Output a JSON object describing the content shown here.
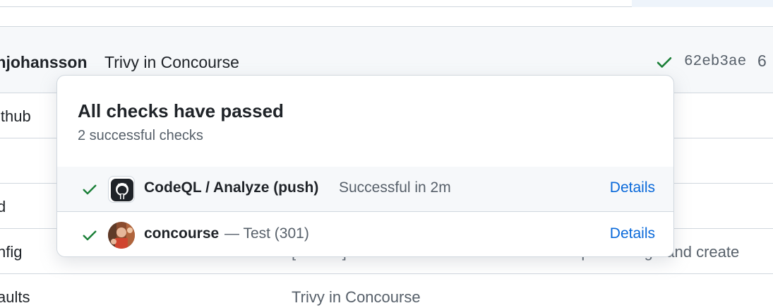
{
  "commit": {
    "author": "jonjohansson",
    "message": "Trivy in Concourse",
    "sha": "62eb3ae",
    "count": "6",
    "status_icon": "check-icon",
    "status_color": "#1a7f37"
  },
  "files": [
    {
      "name": "ithub",
      "message": ""
    },
    {
      "name": "",
      "message": ""
    },
    {
      "name": "d",
      "message": ""
    },
    {
      "name": "nfig",
      "message": "[NAVCI] Use stable version of docker-compose image and create"
    },
    {
      "name": "aults",
      "message": "Trivy in Concourse"
    }
  ],
  "popover": {
    "title": "All checks have passed",
    "subtitle": "2 successful checks",
    "checks": [
      {
        "name": "CodeQL / Analyze (push)",
        "status": "Successful in 2m",
        "details_label": "Details",
        "avatar": "github-logo-icon"
      },
      {
        "name": "concourse",
        "separator": "— Test (301)",
        "details_label": "Details",
        "avatar": "concourse-avatar"
      }
    ]
  },
  "colors": {
    "success": "#1a7f37",
    "link": "#0969da",
    "muted": "#57606a",
    "border": "#d0d7de"
  }
}
